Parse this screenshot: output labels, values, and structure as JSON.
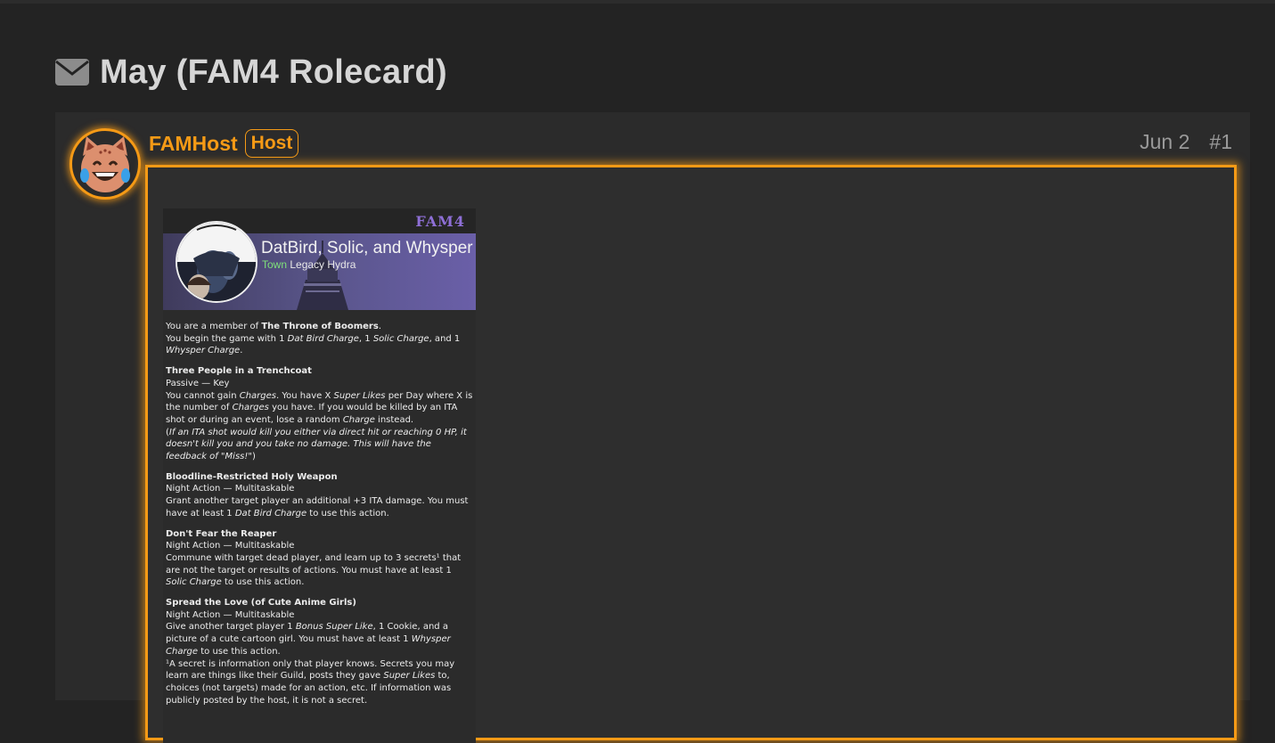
{
  "page": {
    "title": "May (FAM4 Rolecard)",
    "title_icon": "envelope-icon"
  },
  "post": {
    "author": "FAMHost",
    "badge": "Host",
    "date": "Jun 2",
    "number": "#1",
    "avatar_icon": "laughing-cat-face-icon",
    "colors": {
      "accent": "#f59a16",
      "background": "#232323",
      "post_bg": "#2b2b2b"
    }
  },
  "rolecard": {
    "brand": "FAM4",
    "name": "DatBird, Solic, and Whysper",
    "alignment": "Town",
    "role": "Legacy Hydra",
    "colors": {
      "brand": "#8e6fd6",
      "town": "#7fe07a"
    },
    "intro": {
      "l1a": "You are a member of ",
      "l1b": "The Throne of Boomers",
      "l1c": ".",
      "l2a": "You begin the game with 1 ",
      "l2b": "Dat Bird Charge",
      "l2c": ", 1 ",
      "l2d": "Solic Charge",
      "l2e": ", and 1 ",
      "l2f": "Whysper Charge",
      "l2g": "."
    },
    "ability1": {
      "name": "Three People in a Trenchcoat",
      "type": "Passive — Key",
      "d1": "You cannot gain ",
      "d2": "Charges",
      "d3": ". You have X ",
      "d4": "Super Likes",
      "d5": " per Day where X is the number of ",
      "d6": "Charges",
      "d7": " you have. If you would be killed by an ITA shot or during an event, lose a random ",
      "d8": "Charge",
      "d9": " instead.",
      "note_open": "(",
      "note": "If an ITA shot would kill you either via direct hit or reaching 0 HP, it doesn't kill you and you take no damage. This will have the feedback of \"Miss!\"",
      "note_close": ")"
    },
    "ability2": {
      "name": "Bloodline-Restricted Holy Weapon",
      "type": "Night Action — Multitaskable",
      "d1": "Grant another target player an additional +3 ITA damage. You must have at least 1 ",
      "d2": "Dat Bird Charge",
      "d3": " to use this action."
    },
    "ability3": {
      "name": "Don't Fear the Reaper",
      "type": "Night Action — Multitaskable",
      "d1": "Commune with target dead player, and learn up to 3 secrets¹ that are not the target or results of actions. You must have at least 1 ",
      "d2": "Solic Charge",
      "d3": " to use this action."
    },
    "ability4": {
      "name": "Spread the Love (of Cute Anime Girls)",
      "type": "Night Action — Multitaskable",
      "d1": "Give another target player 1 ",
      "d2": "Bonus Super Like",
      "d3": ", 1 Cookie, and a picture of a cute cartoon girl. You must have at least 1 ",
      "d4": "Whysper Charge",
      "d5": " to use this action."
    },
    "footnote": {
      "d1": "¹A secret is information only that player knows. Secrets you may learn are things like their Guild, posts they gave ",
      "d2": "Super Likes",
      "d3": " to, choices (not targets) made for an action, etc. If information was publicly posted by the host, it is not a secret."
    }
  }
}
